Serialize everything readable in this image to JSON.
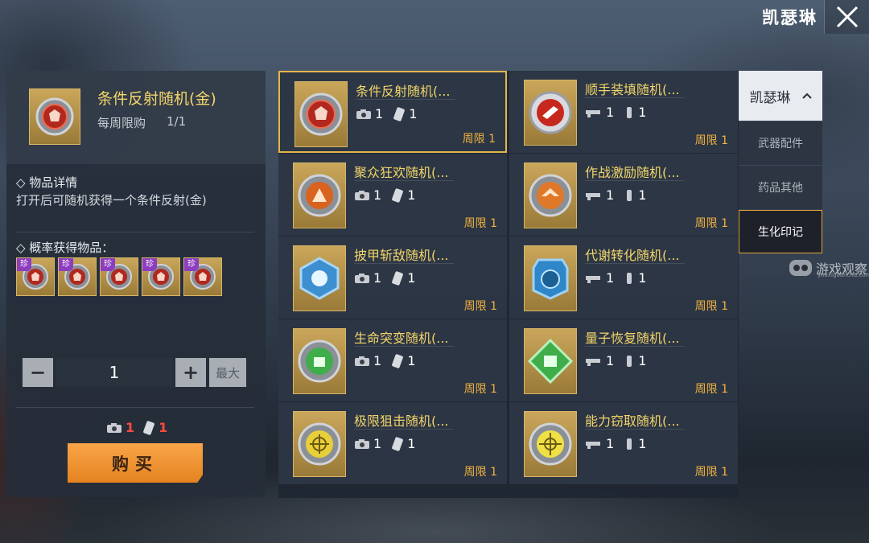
{
  "header": {
    "title": "凯瑟琳"
  },
  "colors": {
    "accent": "#e3b64a",
    "limit": "#f0b23e",
    "buy": "#f39a37",
    "cost_red": "#ff4a3d",
    "rare_tag": "#8d3dbf"
  },
  "detail": {
    "item_name": "条件反射随机(金)",
    "weekly_limit_label": "每周限购",
    "weekly_count": "1/1",
    "info_title": "◇ 物品详情",
    "info_desc": "打开后可随机获得一个条件反射(金)",
    "prob_title": "◇ 概率获得物品：",
    "drops": [
      {
        "tag": "珍"
      },
      {
        "tag": "珍"
      },
      {
        "tag": "珍"
      },
      {
        "tag": "珍"
      },
      {
        "tag": "珍"
      }
    ],
    "quantity": "1",
    "minus": "−",
    "plus": "+",
    "max_label": "最大",
    "cost": {
      "camera": "1",
      "card": "1"
    },
    "buy_label": "购买"
  },
  "items": [
    {
      "name": "条件反射随机(...",
      "cost_a": "1",
      "cost_b": "1",
      "limit": "周限 1",
      "icon": "red-badge-icon"
    },
    {
      "name": "顺手装填随机(...",
      "cost_a": "1",
      "cost_b": "1",
      "limit": "周限 1",
      "icon": "red-badge-icon"
    },
    {
      "name": "聚众狂欢随机(...",
      "cost_a": "1",
      "cost_b": "1",
      "limit": "周限 1",
      "icon": "orange-badge-icon"
    },
    {
      "name": "作战激励随机(...",
      "cost_a": "1",
      "cost_b": "1",
      "limit": "周限 1",
      "icon": "orange-badge-icon"
    },
    {
      "name": "披甲斩敌随机(...",
      "cost_a": "1",
      "cost_b": "1",
      "limit": "周限 1",
      "icon": "blue-badge-icon"
    },
    {
      "name": "代谢转化随机(...",
      "cost_a": "1",
      "cost_b": "1",
      "limit": "周限 1",
      "icon": "blue-badge-icon"
    },
    {
      "name": "生命突变随机(...",
      "cost_a": "1",
      "cost_b": "1",
      "limit": "周限 1",
      "icon": "green-badge-icon"
    },
    {
      "name": "量子恢复随机(...",
      "cost_a": "1",
      "cost_b": "1",
      "limit": "周限 1",
      "icon": "green-badge-icon"
    },
    {
      "name": "极限狙击随机(...",
      "cost_a": "1",
      "cost_b": "1",
      "limit": "周限 1",
      "icon": "yellow-badge-icon"
    },
    {
      "name": "能力窃取随机(...",
      "cost_a": "1",
      "cost_b": "1",
      "limit": "周限 1",
      "icon": "yellow-badge-icon"
    }
  ],
  "tabs": {
    "header": "凯瑟琳",
    "items": [
      "武器配件",
      "药品其他",
      "生化印记"
    ]
  },
  "watermark": {
    "text": "游戏观察",
    "sub": "youxiguancha.com"
  }
}
